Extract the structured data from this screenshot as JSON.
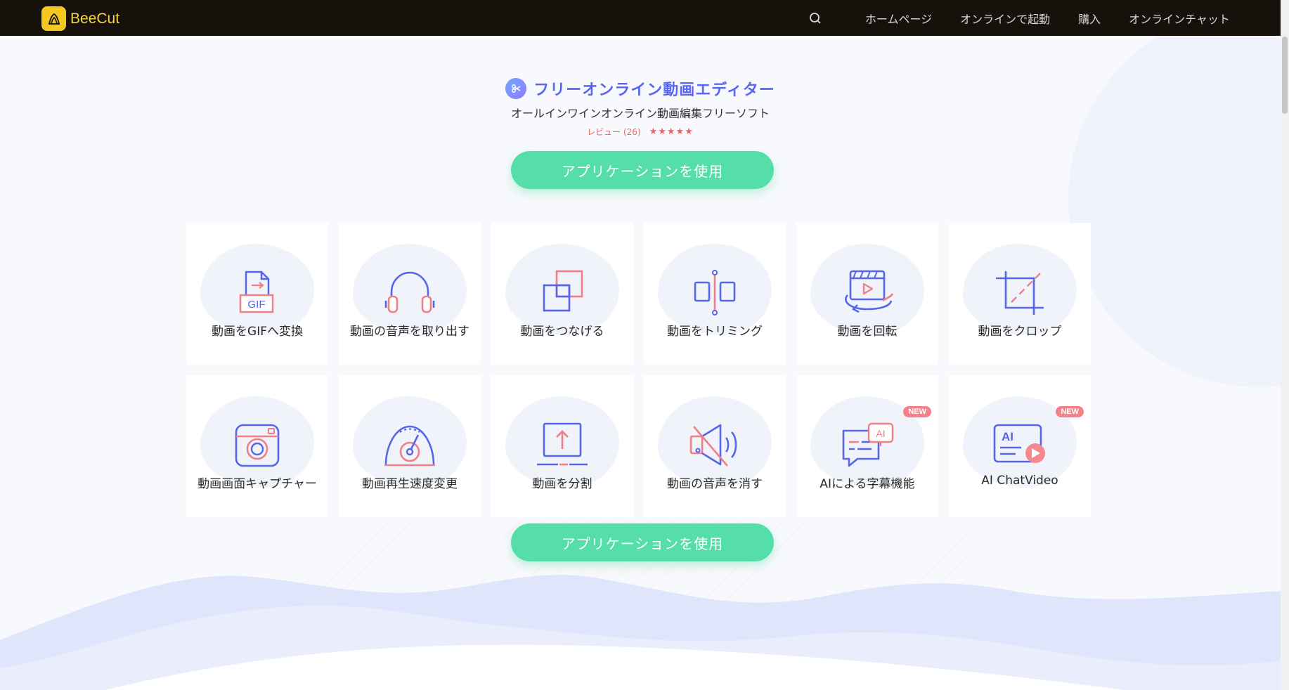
{
  "header": {
    "logo_text": "BeeCut",
    "nav": [
      "ホームページ",
      "オンラインで起動",
      "購入",
      "オンラインチャット"
    ]
  },
  "hero": {
    "title": "フリーオンライン動画エディター",
    "subtitle": "オールインワインオンライン動画編集フリーソフト",
    "review": "レビュー (26)",
    "stars": "★★★★★",
    "rating_value": 5
  },
  "cta_label": "アプリケーションを使用",
  "tools": [
    {
      "label": "動画をGIFへ変換",
      "icon": "gif-icon"
    },
    {
      "label": "動画の音声を取り出す",
      "icon": "headphones-icon"
    },
    {
      "label": "動画をつなげる",
      "icon": "merge-icon"
    },
    {
      "label": "動画をトリミング",
      "icon": "trim-icon"
    },
    {
      "label": "動画を回転",
      "icon": "rotate-icon"
    },
    {
      "label": "動画をクロップ",
      "icon": "crop-icon"
    },
    {
      "label": "動画画面キャプチャー",
      "icon": "camera-icon"
    },
    {
      "label": "動画再生速度変更",
      "icon": "speed-icon"
    },
    {
      "label": "動画を分割",
      "icon": "split-icon"
    },
    {
      "label": "動画の音声を消す",
      "icon": "mute-icon"
    },
    {
      "label": "AIによる字幕機能",
      "icon": "ai-subtitle-icon",
      "badge": "NEW"
    },
    {
      "label": "AI ChatVideo",
      "icon": "ai-chatvideo-icon",
      "badge": "NEW"
    }
  ],
  "colors": {
    "accent": "#5a67f2",
    "cta": "#55ddaa",
    "star": "#f06464",
    "badge": "#f5808a",
    "topbar": "#16120b"
  }
}
